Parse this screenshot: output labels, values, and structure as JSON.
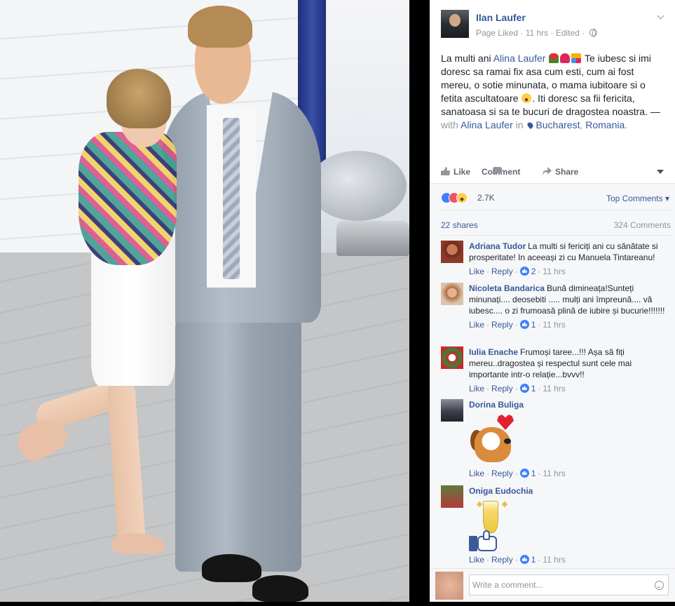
{
  "post": {
    "author": "Ilan Laufer",
    "meta_prefix": "Page Liked · 11 hrs · Edited ·",
    "text": {
      "p1": "La multi ani ",
      "tag1": "Alina Laufer",
      "p2": " Te iubesc si imi doresc sa ramai fix asa cum esti, cum ai fost mereu, o sotie minunata, o mama iubitoare si o fetita ascultatoare ",
      "p3": ". Iti doresc sa fii fericita, sanatoasa si sa te bucuri de dragostea noastra. —",
      "with": " with ",
      "tag2": "Alina Laufer",
      "in": " in ",
      "place": "Bucharest",
      "comma": ", ",
      "country": "Romania",
      "period": "."
    }
  },
  "actions": {
    "like": "Like",
    "comment": "Comment",
    "share": "Share"
  },
  "summary": {
    "reactions_count": "2.7K",
    "sort_label": "Top Comments ▾",
    "shares": "22 shares",
    "comments": "324 Comments"
  },
  "comments": [
    {
      "author": "Adriana Tudor",
      "text": "La multi si fericiți ani cu sănătate si prosperitate! In aceeași zi cu Manuela Tintareanu!",
      "like": "Like",
      "reply": "Reply",
      "likes": "2",
      "time": "11 hrs"
    },
    {
      "author": "Nicoleta Bandarica",
      "text": "Bună dimineața!Sunteți minunați.... deosebiti ..... mulți ani împreună.... vă iubesc.... o zi frumoasă plină de iubire și bucurie!!!!!!!",
      "like": "Like",
      "reply": "Reply",
      "likes": "1",
      "time": "11 hrs"
    },
    {
      "author": "Iulia Enache",
      "text": "Frumoși taree...!!! Așa să fiți mereu..dragostea și respectul sunt cele mai importante intr-o relație...bvvv!!",
      "like": "Like",
      "reply": "Reply",
      "likes": "1",
      "time": "11 hrs"
    },
    {
      "author": "Dorina Buliga",
      "text": "",
      "like": "Like",
      "reply": "Reply",
      "likes": "1",
      "time": "11 hrs"
    },
    {
      "author": "Oniga Eudochia",
      "text": "",
      "like": "Like",
      "reply": "Reply",
      "likes": "1",
      "time": "11 hrs"
    }
  ],
  "composer": {
    "placeholder": "Write a comment..."
  },
  "icons": {
    "header": [
      "page-avatar",
      "globe-icon",
      "chevron-down-icon"
    ],
    "actions": [
      "like-icon",
      "comment-icon",
      "share-icon",
      "caret-down-icon"
    ],
    "reactions": [
      "like-reaction-icon",
      "love-reaction-icon",
      "haha-reaction-icon"
    ],
    "stickers": [
      "dog-heart-sticker",
      "champagne-thumbs-up-sticker"
    ],
    "composer": [
      "emoji-icon"
    ]
  },
  "colors": {
    "link": "#365899",
    "meta": "#90949c",
    "like_blue": "#4080ff",
    "love_red": "#f25268",
    "panel_bg": "#f6f7f9"
  }
}
